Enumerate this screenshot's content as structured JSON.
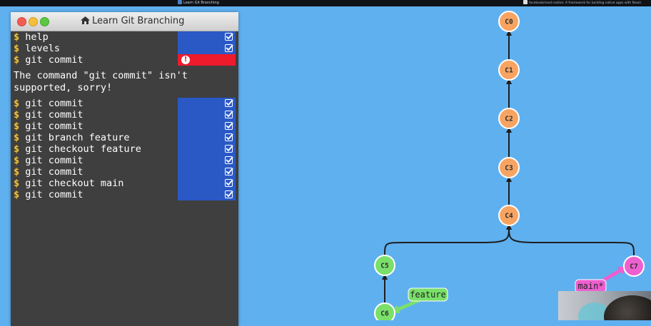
{
  "browser": {
    "tab_left": "Learn Git Branching",
    "tab_right": "facebook/react-native: A framework for building native apps with React."
  },
  "terminal": {
    "title": "Learn Git Branching",
    "prompt_symbol": "$",
    "lines_before": [
      {
        "text": "help",
        "status": "ok"
      },
      {
        "text": "levels",
        "status": "ok"
      },
      {
        "text": "git commit",
        "status": "error"
      }
    ],
    "error_message": "The command \"git commit\" isn't\nsupported, sorry!",
    "lines_after": [
      {
        "text": "git commit",
        "status": "ok"
      },
      {
        "text": "git commit",
        "status": "ok"
      },
      {
        "text": "git commit",
        "status": "ok"
      },
      {
        "text": "git branch feature",
        "status": "ok"
      },
      {
        "text": "git checkout feature",
        "status": "ok"
      },
      {
        "text": "git commit",
        "status": "ok"
      },
      {
        "text": "git commit",
        "status": "ok"
      },
      {
        "text": "git checkout main",
        "status": "ok"
      },
      {
        "text": "git commit",
        "status": "ok"
      }
    ]
  },
  "graph": {
    "commits": [
      {
        "id": "C0",
        "parent": null,
        "color": "#f7a463"
      },
      {
        "id": "C1",
        "parent": "C0",
        "color": "#f7a463"
      },
      {
        "id": "C2",
        "parent": "C1",
        "color": "#f7a463"
      },
      {
        "id": "C3",
        "parent": "C2",
        "color": "#f7a463"
      },
      {
        "id": "C4",
        "parent": "C3",
        "color": "#f7a463"
      },
      {
        "id": "C5",
        "parent": "C4",
        "color": "#7ae06a"
      },
      {
        "id": "C6",
        "parent": "C5",
        "color": "#7ae06a"
      },
      {
        "id": "C7",
        "parent": "C4",
        "color": "#ee5fcf"
      }
    ],
    "branches": [
      {
        "name": "feature",
        "target": "C6",
        "color": "#7ae06a"
      },
      {
        "name": "main*",
        "target": "C7",
        "color": "#ee5fcf"
      }
    ]
  },
  "colors": {
    "background": "#5fb0ef",
    "ok": "#2a59c6",
    "error": "#ee1b2c",
    "prompt": "#f2c33c"
  }
}
